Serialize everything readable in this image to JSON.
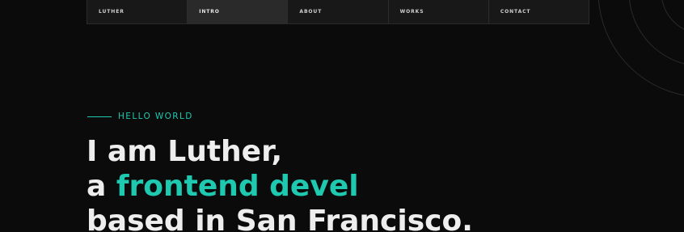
{
  "nav": {
    "items": [
      {
        "label": "LUTHER",
        "active": false
      },
      {
        "label": "INTRO",
        "active": true
      },
      {
        "label": "ABOUT",
        "active": false
      },
      {
        "label": "WORKS",
        "active": false
      },
      {
        "label": "CONTACT",
        "active": false
      }
    ]
  },
  "hero": {
    "eyebrow": "HELLO WORLD",
    "line1": "I am Luther,",
    "line2_prefix": "a ",
    "line2_typed": "frontend devel",
    "line3": "based in San Francisco."
  },
  "colors": {
    "background": "#0b0b0b",
    "accent": "#1ec9b0",
    "nav_bg": "#181818",
    "nav_active_bg": "#2a2a2a"
  }
}
